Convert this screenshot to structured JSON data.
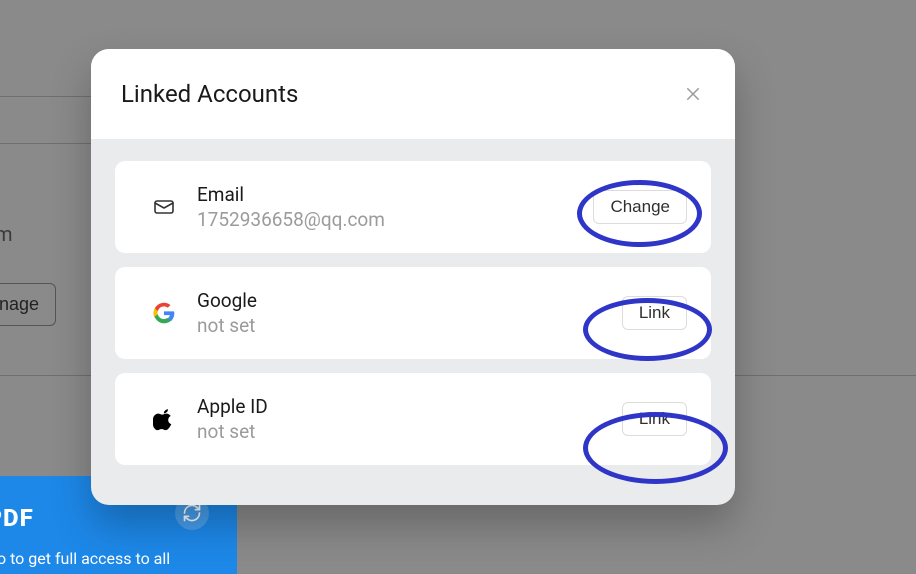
{
  "background": {
    "text1": "m",
    "manage_button": "anage",
    "promo_logo": "JPDF",
    "promo_line": "o to get full access to all"
  },
  "modal": {
    "title": "Linked Accounts",
    "rows": [
      {
        "label": "Email",
        "sub": "1752936658@qq.com",
        "button": "Change"
      },
      {
        "label": "Google",
        "sub": "not set",
        "button": "Link"
      },
      {
        "label": "Apple ID",
        "sub": "not set",
        "button": "Link"
      }
    ]
  }
}
